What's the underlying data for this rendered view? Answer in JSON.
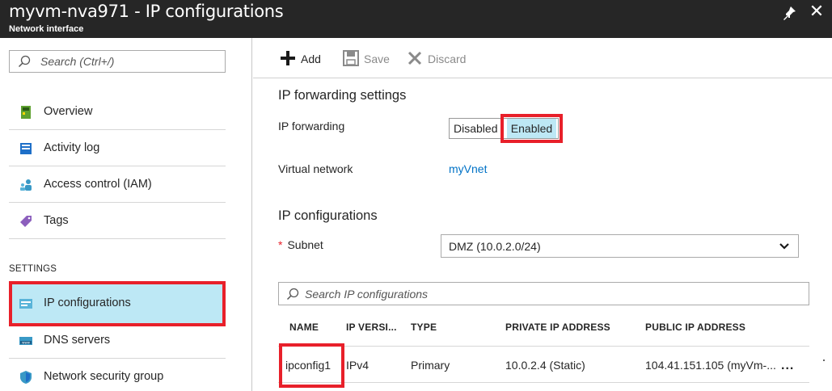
{
  "window": {
    "title": "myvm-nva971 - IP configurations",
    "subtitle": "Network interface",
    "colors": {
      "titlebar_bg": "#262626",
      "accent_link": "#0072c6",
      "selection_bg": "#bde8f5",
      "highlight_border": "#e8202a"
    }
  },
  "sidebar": {
    "search_placeholder": "Search (Ctrl+/)",
    "items": [
      {
        "label": "Overview",
        "icon": "overview-icon"
      },
      {
        "label": "Activity log",
        "icon": "activity-log-icon"
      },
      {
        "label": "Access control (IAM)",
        "icon": "people-icon"
      },
      {
        "label": "Tags",
        "icon": "tag-icon"
      }
    ],
    "section_settings": "SETTINGS",
    "settings_items": [
      {
        "label": "IP configurations",
        "icon": "ip-config-icon",
        "selected": true
      },
      {
        "label": "DNS servers",
        "icon": "dns-icon"
      },
      {
        "label": "Network security group",
        "icon": "shield-icon"
      }
    ]
  },
  "toolbar": {
    "add_label": "Add",
    "save_label": "Save",
    "discard_label": "Discard"
  },
  "forwarding": {
    "heading": "IP forwarding settings",
    "ip_forwarding_label": "IP forwarding",
    "option_disabled": "Disabled",
    "option_enabled": "Enabled",
    "selected": "Enabled",
    "vnet_label": "Virtual network",
    "vnet_value": "myVnet"
  },
  "ipconfigs": {
    "heading": "IP configurations",
    "subnet_required_mark": "*",
    "subnet_label": "Subnet",
    "subnet_value": "DMZ (10.0.2.0/24)",
    "search_placeholder": "Search IP configurations",
    "columns": [
      "NAME",
      "IP VERSI...",
      "TYPE",
      "PRIVATE IP ADDRESS",
      "PUBLIC IP ADDRESS"
    ],
    "rows": [
      {
        "name": "ipconfig1",
        "ip_version": "IPv4",
        "type": "Primary",
        "private_ip": "10.0.2.4 (Static)",
        "public_ip": "104.41.151.105 (myVm-...",
        "more": "..."
      }
    ]
  }
}
